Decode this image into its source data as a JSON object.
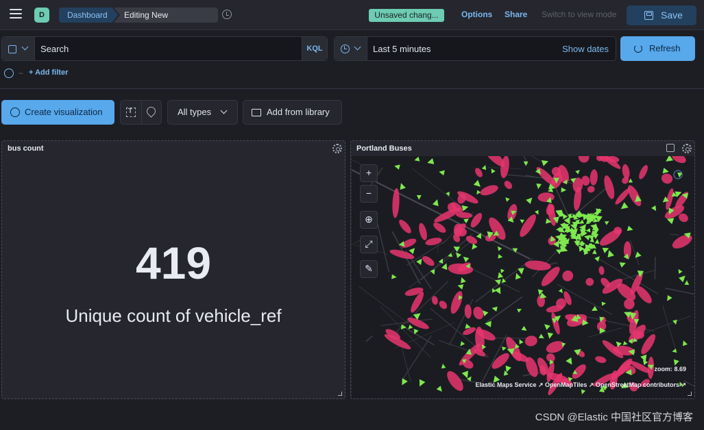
{
  "header": {
    "space_initial": "D",
    "breadcrumbs": [
      "Dashboard",
      "Editing New Dashboard"
    ],
    "unsaved_badge": "Unsaved chang...",
    "options": "Options",
    "share": "Share",
    "switch_mode": "Switch to view mode",
    "save": "Save"
  },
  "query": {
    "placeholder": "Search",
    "language": "KQL",
    "time_range": "Last 5 minutes",
    "show_dates": "Show dates",
    "refresh": "Refresh",
    "add_filter": "+ Add filter"
  },
  "toolbar": {
    "create": "Create visualization",
    "all_types": "All types",
    "add_from_library": "Add from library"
  },
  "panels": {
    "bus_count": {
      "title": "bus count",
      "value": "419",
      "label": "Unique count of vehicle_ref"
    },
    "map": {
      "title": "Portland Buses",
      "zoom": "zoom: 8.69",
      "attribution": "Elastic Maps Service ↗  OpenMapTiles ↗  OpenStreetMap contributors ↗",
      "colors": {
        "heat": "#e8356e",
        "vehicle": "#7ee84e",
        "road": "#3a3b42"
      }
    }
  },
  "watermark": "CSDN @Elastic 中国社区官方博客"
}
